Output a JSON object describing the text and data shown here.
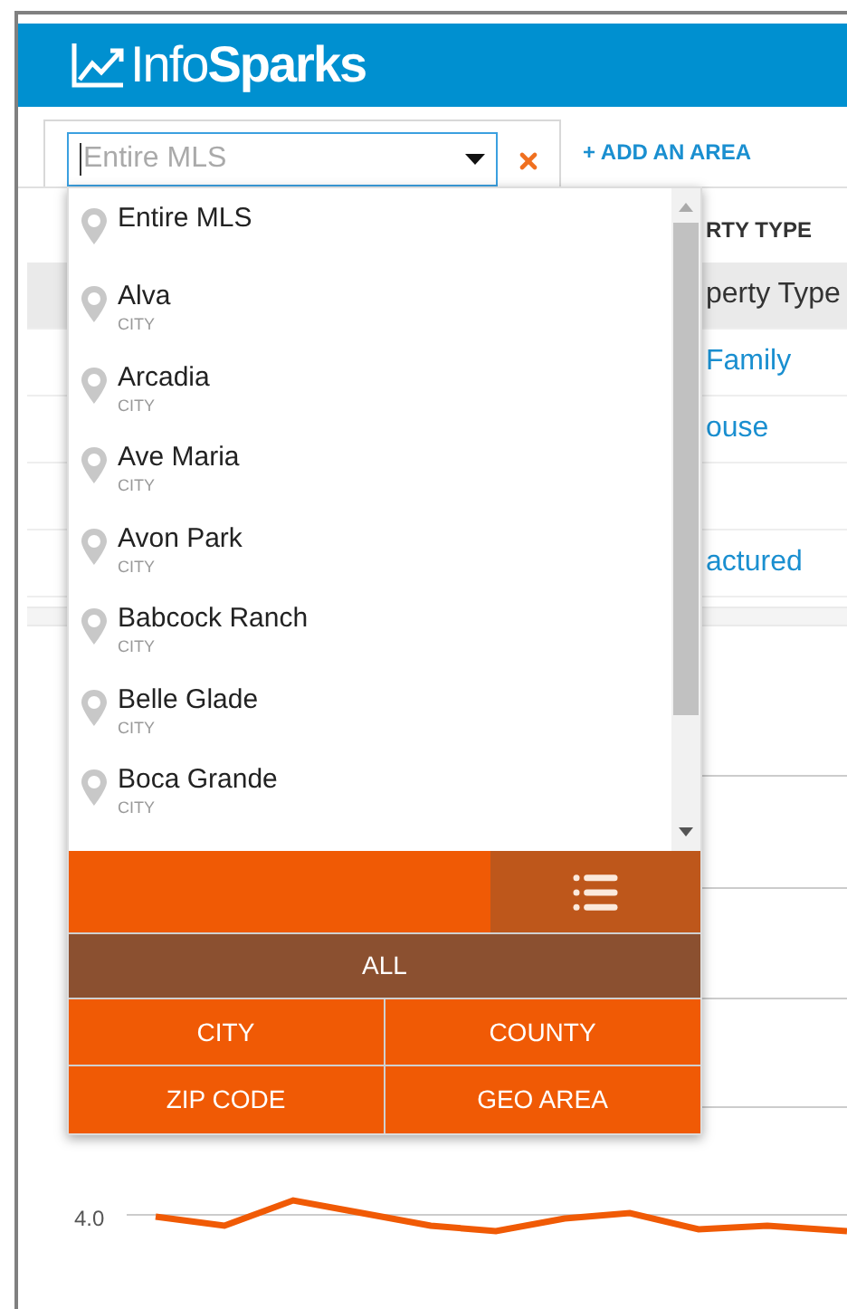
{
  "header": {
    "logo_light": "Info",
    "logo_bold": "Sparks"
  },
  "area_search": {
    "placeholder": "Entire MLS",
    "add_area": "+ ADD AN AREA"
  },
  "dropdown": {
    "items": [
      {
        "name": "Entire MLS"
      },
      {
        "name": "Alva",
        "type": "CITY"
      },
      {
        "name": "Arcadia",
        "type": "CITY"
      },
      {
        "name": "Ave Maria",
        "type": "CITY"
      },
      {
        "name": "Avon Park",
        "type": "CITY"
      },
      {
        "name": "Babcock Ranch",
        "type": "CITY"
      },
      {
        "name": "Belle Glade",
        "type": "CITY"
      },
      {
        "name": "Boca Grande",
        "type": "CITY"
      }
    ],
    "filters": [
      {
        "label": "ALL",
        "selected": true
      },
      {
        "label": "CITY",
        "selected": false
      },
      {
        "label": "COUNTY",
        "selected": false
      },
      {
        "label": "ZIP CODE",
        "selected": false
      },
      {
        "label": "GEO AREA",
        "selected": false
      }
    ]
  },
  "table": {
    "column_header": "RTY TYPE",
    "rows": [
      {
        "label": "perty Type",
        "selected": true
      },
      {
        "label": "Family",
        "selected": false
      },
      {
        "label": "ouse",
        "selected": false
      },
      {
        "selected": false
      },
      {
        "label": "actured",
        "selected": false
      }
    ]
  },
  "chart": {
    "y_tick": "4.0"
  }
}
